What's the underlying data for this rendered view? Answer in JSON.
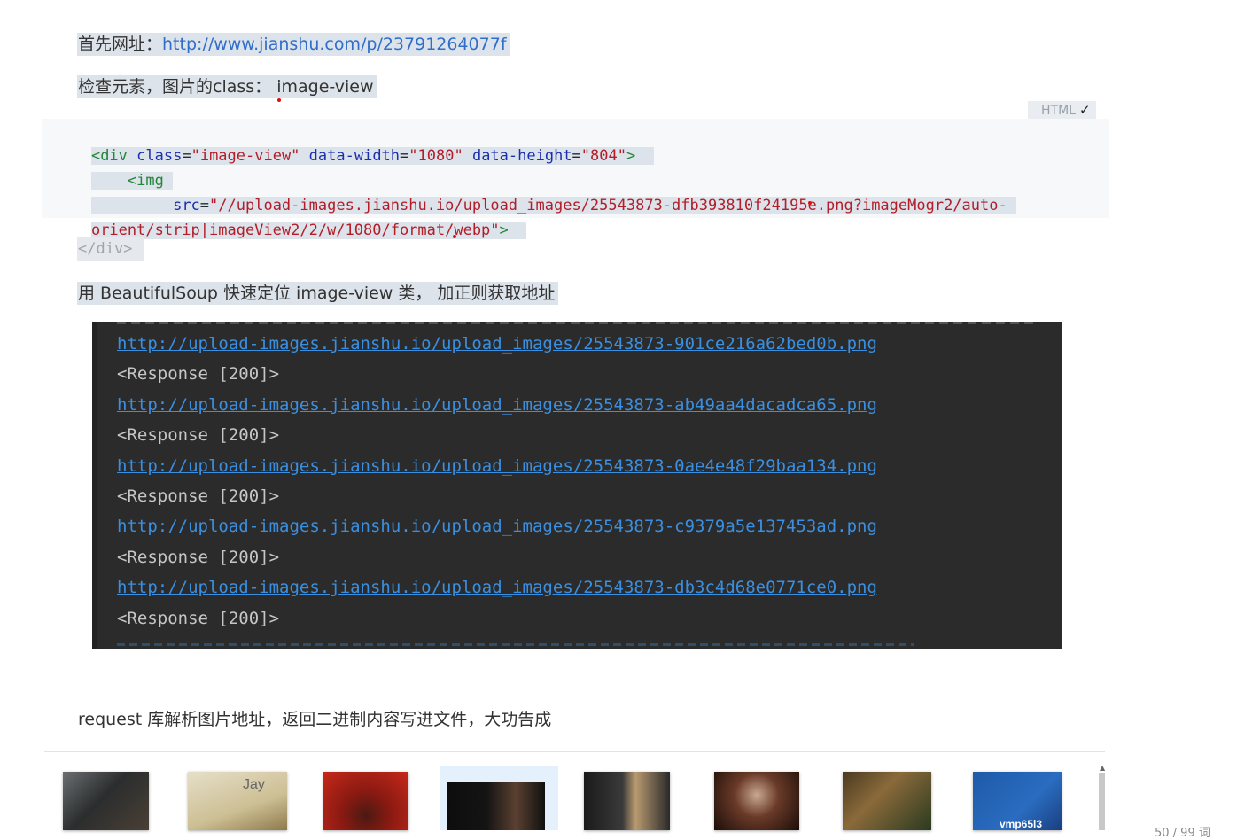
{
  "article": {
    "p1_label": "首先网址：",
    "p1_url": "http://www.jianshu.com/p/23791264077f",
    "p2": "检查元素，图片的class： image-view",
    "code": {
      "lang": "HTML",
      "check": "✓",
      "l1_open": "<div",
      "l1_attr1": "class",
      "l1_val1": "\"image-view\"",
      "l1_attr2": "data-width",
      "l1_val2": "\"1080\"",
      "l1_attr3": "data-height",
      "l1_val3": "\"804\"",
      "l1_close": ">",
      "l2_tag": "<img",
      "l3_attr": "src",
      "l3_val": "\"//upload-images.jianshu.io/upload_images/25543873-dfb393810f24195e.png?imageMogr2/auto-",
      "l4_val": "orient/strip|imageView2/2/w/1080/format/webp\"",
      "l4_close": ">"
    },
    "end_div": "</div>",
    "p3": "用 BeautifulSoup 快速定位  image-view  类， 加正则获取地址",
    "terminal": [
      {
        "kind": "link",
        "text": "http://upload-images.jianshu.io/upload_images/25543873-901ce216a62bed0b.png"
      },
      {
        "kind": "resp",
        "text": "<Response [200]>"
      },
      {
        "kind": "link",
        "text": "http://upload-images.jianshu.io/upload_images/25543873-ab49aa4dacadca65.png"
      },
      {
        "kind": "resp",
        "text": "<Response [200]>"
      },
      {
        "kind": "link",
        "text": "http://upload-images.jianshu.io/upload_images/25543873-0ae4e48f29baa134.png"
      },
      {
        "kind": "resp",
        "text": "<Response [200]>"
      },
      {
        "kind": "link",
        "text": "http://upload-images.jianshu.io/upload_images/25543873-c9379a5e137453ad.png"
      },
      {
        "kind": "resp",
        "text": "<Response [200]>"
      },
      {
        "kind": "link",
        "text": "http://upload-images.jianshu.io/upload_images/25543873-db3c4d68e0771ce0.png"
      },
      {
        "kind": "resp",
        "text": "<Response [200]>"
      }
    ],
    "p4": "request 库解析图片地址，返回二进制内容写进文件，大功告成"
  },
  "gallery": {
    "thumb2_text": "Jay",
    "thumb8_text": "vmp65l3",
    "counter": "50 / 99 词"
  },
  "colors": {
    "highlight": "#dde3ea",
    "link": "#2f6ec9",
    "terminal_bg": "#2b2b2b",
    "terminal_link": "#3a8fe0"
  }
}
